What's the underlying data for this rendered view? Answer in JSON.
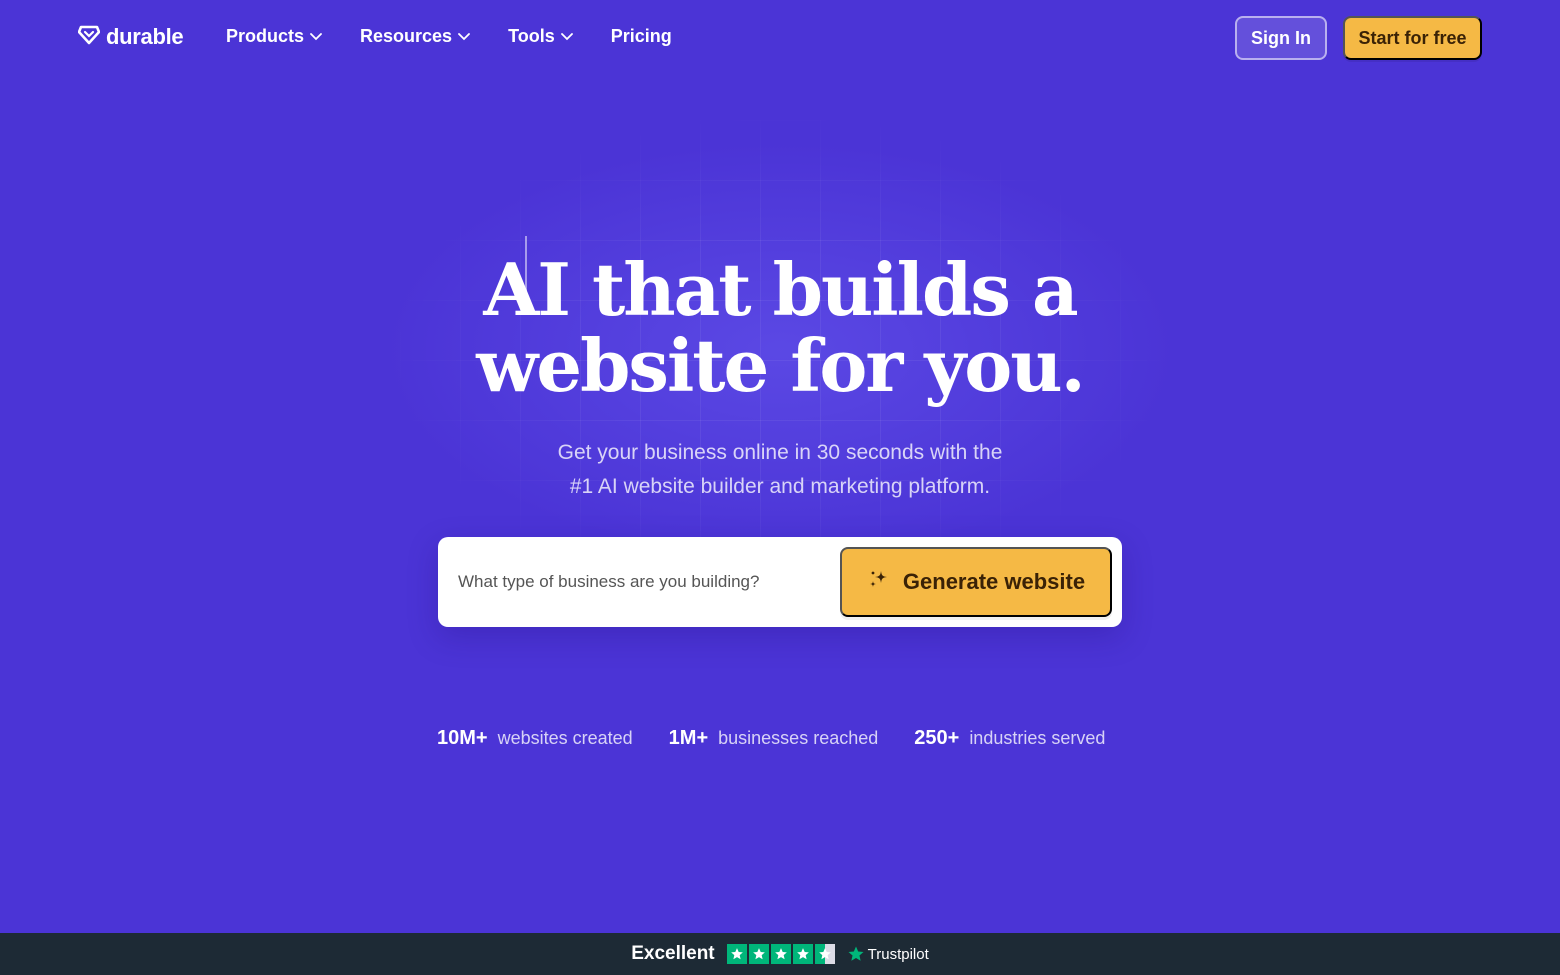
{
  "brand": {
    "name": "durable",
    "logo_icon": "diamond-heart-icon"
  },
  "nav": {
    "links": [
      {
        "label": "Products",
        "has_dropdown": true
      },
      {
        "label": "Resources",
        "has_dropdown": true
      },
      {
        "label": "Tools",
        "has_dropdown": true
      },
      {
        "label": "Pricing",
        "has_dropdown": false
      }
    ],
    "sign_in": "Sign In",
    "start_free": "Start for free"
  },
  "hero": {
    "headline_line1": "AI that builds a",
    "headline_line2": "website for you.",
    "sub_line1": "Get your business online in 30 seconds with the",
    "sub_line2": "#1 AI website builder and marketing platform."
  },
  "search": {
    "placeholder": "What type of business are you building?",
    "value": "",
    "button_label": "Generate website",
    "button_icon": "sparkle-icon"
  },
  "stats": [
    {
      "number": "10M+",
      "label": "websites created"
    },
    {
      "number": "1M+",
      "label": "businesses reached"
    },
    {
      "number": "250+",
      "label": "industries served"
    }
  ],
  "trustpilot": {
    "rating_text": "Excellent",
    "stars": 4.5,
    "brand": "Trustpilot"
  },
  "colors": {
    "background": "#4b34d6",
    "accent": "#f5b945",
    "footer_bar": "#1d2a35",
    "trustpilot_green": "#00b67a"
  }
}
